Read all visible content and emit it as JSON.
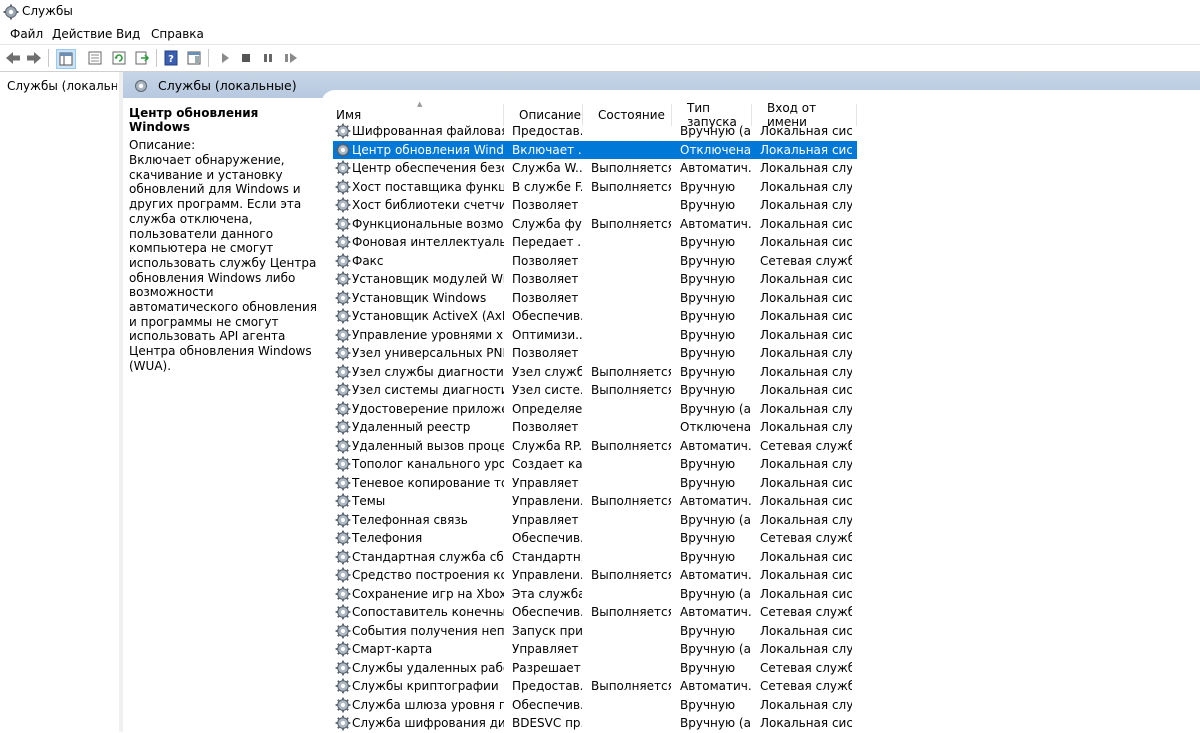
{
  "window": {
    "title": "Службы"
  },
  "menu": [
    "Файл",
    "Действие",
    "Вид",
    "Справка"
  ],
  "toolbar": {
    "buttons": [
      "back-arrow-icon",
      "forward-arrow-icon",
      "console-tree-icon",
      "properties-icon",
      "refresh-icon",
      "export-icon",
      "help-icon",
      "show-hide-pane-icon",
      "start-service-icon",
      "stop-service-icon",
      "pause-service-icon",
      "restart-service-icon"
    ]
  },
  "tree": {
    "item_label": "Службы (локальн"
  },
  "content_header": {
    "title": "Службы (локальные)"
  },
  "description": {
    "service_name": "Центр обновления Windows",
    "label": "Описание:",
    "text": "Включает обнаружение, скачивание и установку обновлений для Windows и других программ. Если эта служба отключена, пользователи данного компьютера не смогут использовать службу Центра обновления Windows либо возможности автоматического обновления и программы не смогут использовать API агента Центра обновления Windows (WUA)."
  },
  "columns": [
    "Имя",
    "Описание",
    "Состояние",
    "Тип запуска",
    "Вход от имени"
  ],
  "colors": {
    "selection": "#0078d7",
    "header_bar": "#c7d5e7"
  },
  "services": [
    {
      "name": "Шифрованная файловая си...",
      "desc": "Предостав...",
      "state": "",
      "start": "Вручную (а...",
      "logon": "Локальная сист..."
    },
    {
      "name": "Центр обновления Windows",
      "desc": "Включает ...",
      "state": "",
      "start": "Отключена",
      "logon": "Локальная сист...",
      "selected": true
    },
    {
      "name": "Центр обеспечения безоп...",
      "desc": "Служба W...",
      "state": "Выполняется",
      "start": "Автоматич...",
      "logon": "Локальная слу..."
    },
    {
      "name": "Хост поставщика функции ...",
      "desc": "В службе F...",
      "state": "Выполняется",
      "start": "Вручную",
      "logon": "Локальная слу..."
    },
    {
      "name": "Хост библиотеки счетчика ...",
      "desc": "Позволяет ...",
      "state": "",
      "start": "Вручную",
      "logon": "Локальная слу..."
    },
    {
      "name": "Функциональные возможн...",
      "desc": "Служба фу...",
      "state": "Выполняется",
      "start": "Автоматич...",
      "logon": "Локальная сист..."
    },
    {
      "name": "Фоновая интеллектуальная...",
      "desc": "Передает ...",
      "state": "",
      "start": "Вручную",
      "logon": "Локальная сист..."
    },
    {
      "name": "Факс",
      "desc": "Позволяет ...",
      "state": "",
      "start": "Вручную",
      "logon": "Сетевая служба"
    },
    {
      "name": "Установщик модулей Wind...",
      "desc": "Позволяет ...",
      "state": "",
      "start": "Вручную",
      "logon": "Локальная сист..."
    },
    {
      "name": "Установщик Windows",
      "desc": "Позволяет ...",
      "state": "",
      "start": "Вручную",
      "logon": "Локальная сист..."
    },
    {
      "name": "Установщик ActiveX (AxInst...",
      "desc": "Обеспечив...",
      "state": "",
      "start": "Вручную",
      "logon": "Локальная сист..."
    },
    {
      "name": "Управление уровнями хра...",
      "desc": "Оптимизи...",
      "state": "",
      "start": "Вручную",
      "logon": "Локальная сист..."
    },
    {
      "name": "Узел универсальных PNP-у...",
      "desc": "Позволяет ...",
      "state": "",
      "start": "Вручную",
      "logon": "Локальная слу..."
    },
    {
      "name": "Узел службы диагностики",
      "desc": "Узел служб...",
      "state": "Выполняется",
      "start": "Вручную",
      "logon": "Локальная слу..."
    },
    {
      "name": "Узел системы диагностики",
      "desc": "Узел систе...",
      "state": "Выполняется",
      "start": "Вручную",
      "logon": "Локальная сист..."
    },
    {
      "name": "Удостоверение приложения",
      "desc": "Определяе...",
      "state": "",
      "start": "Вручную (а...",
      "logon": "Локальная слу..."
    },
    {
      "name": "Удаленный реестр",
      "desc": "Позволяет ...",
      "state": "",
      "start": "Отключена",
      "logon": "Локальная слу..."
    },
    {
      "name": "Удаленный вызов процеду...",
      "desc": "Служба RP...",
      "state": "Выполняется",
      "start": "Автоматич...",
      "logon": "Сетевая служба"
    },
    {
      "name": "Тополог канального уровня",
      "desc": "Создает ка...",
      "state": "",
      "start": "Вручную",
      "logon": "Локальная слу..."
    },
    {
      "name": "Теневое копирование тома",
      "desc": "Управляет ...",
      "state": "",
      "start": "Вручную",
      "logon": "Локальная сист..."
    },
    {
      "name": "Темы",
      "desc": "Управлени...",
      "state": "Выполняется",
      "start": "Автоматич...",
      "logon": "Локальная сист..."
    },
    {
      "name": "Телефонная связь",
      "desc": "Управляет ...",
      "state": "",
      "start": "Вручную (а...",
      "logon": "Локальная слу..."
    },
    {
      "name": "Телефония",
      "desc": "Обеспечив...",
      "state": "",
      "start": "Вручную",
      "logon": "Сетевая служба"
    },
    {
      "name": "Стандартная служба сбор...",
      "desc": "Стандартн...",
      "state": "",
      "start": "Вручную",
      "logon": "Локальная сист..."
    },
    {
      "name": "Средство построения коне...",
      "desc": "Управлени...",
      "state": "Выполняется",
      "start": "Автоматич...",
      "logon": "Локальная сист..."
    },
    {
      "name": "Сохранение игр на Xbox Live",
      "desc": "Эта служба...",
      "state": "",
      "start": "Вручную (а...",
      "logon": "Локальная сист..."
    },
    {
      "name": "Сопоставитель конечных т...",
      "desc": "Обеспечив...",
      "state": "Выполняется",
      "start": "Автоматич...",
      "logon": "Сетевая служба"
    },
    {
      "name": "События получения неподд...",
      "desc": "Запуск при...",
      "state": "",
      "start": "Вручную",
      "logon": "Локальная сист..."
    },
    {
      "name": "Смарт-карта",
      "desc": "Управляет ...",
      "state": "",
      "start": "Вручную (а...",
      "logon": "Локальная слу..."
    },
    {
      "name": "Службы удаленных рабочи...",
      "desc": "Разрешает ...",
      "state": "",
      "start": "Вручную",
      "logon": "Сетевая служба"
    },
    {
      "name": "Службы криптографии",
      "desc": "Предостав...",
      "state": "Выполняется",
      "start": "Автоматич...",
      "logon": "Сетевая служба"
    },
    {
      "name": "Служба шлюза уровня при...",
      "desc": "Обеспечив...",
      "state": "",
      "start": "Вручную",
      "logon": "Локальная слу..."
    },
    {
      "name": "Служба шифрования диско...",
      "desc": "BDESVC пр...",
      "state": "",
      "start": "Вручную (а...",
      "logon": "Локальная сист..."
    }
  ]
}
